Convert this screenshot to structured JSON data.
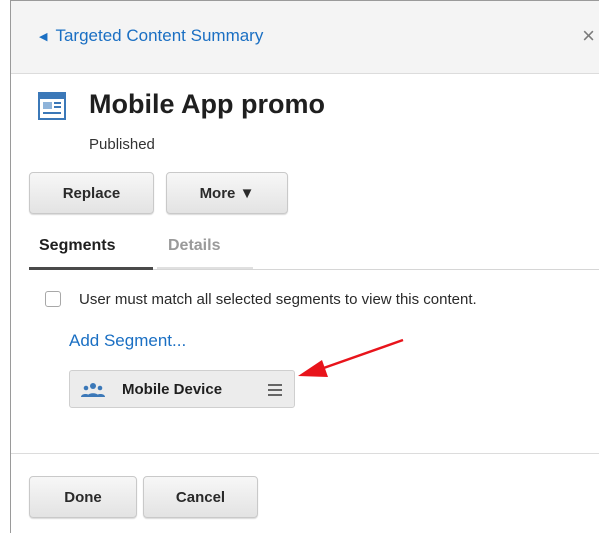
{
  "header": {
    "back_link": "Targeted Content Summary",
    "close": "×"
  },
  "content": {
    "title": "Mobile App promo",
    "status": "Published"
  },
  "actions": {
    "replace": "Replace",
    "more": "More ▼"
  },
  "tabs": [
    {
      "label": "Segments",
      "active": true
    },
    {
      "label": "Details",
      "active": false
    }
  ],
  "segments_panel": {
    "match_all_label": "User must match all selected segments to view this content.",
    "match_all_checked": false,
    "add_segment": "Add Segment...",
    "segments": [
      {
        "label": "Mobile Device"
      }
    ]
  },
  "footer": {
    "done": "Done",
    "cancel": "Cancel"
  },
  "colors": {
    "link": "#1a6fc3",
    "annotation_arrow": "#e8141b",
    "icon_blue": "#3b78b8"
  }
}
